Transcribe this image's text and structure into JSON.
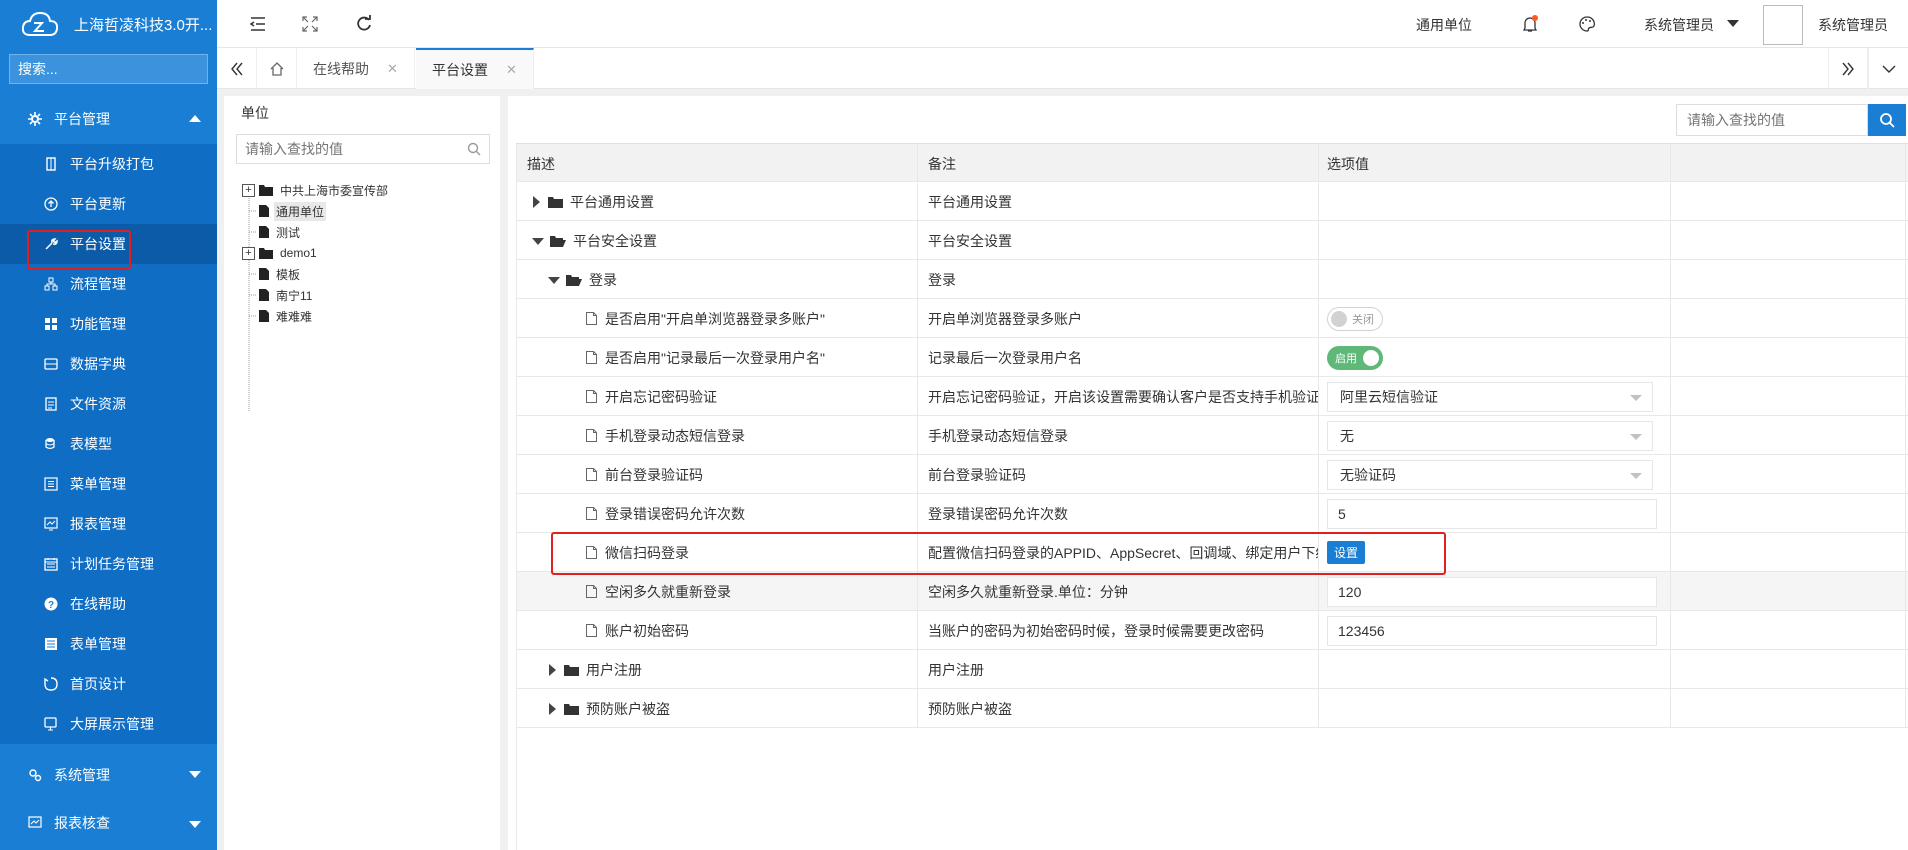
{
  "app": {
    "title": "上海哲凌科技3.0开..."
  },
  "sidebar": {
    "search_placeholder": "搜索...",
    "group_platform": "平台管理",
    "items": [
      {
        "label": "平台升级打包",
        "icon": "package-icon"
      },
      {
        "label": "平台更新",
        "icon": "upload-icon"
      },
      {
        "label": "平台设置",
        "icon": "wrench-icon"
      },
      {
        "label": "流程管理",
        "icon": "flow-icon"
      },
      {
        "label": "功能管理",
        "icon": "grid-icon"
      },
      {
        "label": "数据字典",
        "icon": "dictionary-icon"
      },
      {
        "label": "文件资源",
        "icon": "file-icon"
      },
      {
        "label": "表模型",
        "icon": "database-icon"
      },
      {
        "label": "菜单管理",
        "icon": "menu-icon"
      },
      {
        "label": "报表管理",
        "icon": "chart-icon"
      },
      {
        "label": "计划任务管理",
        "icon": "calendar-icon"
      },
      {
        "label": "在线帮助",
        "icon": "help-icon"
      },
      {
        "label": "表单管理",
        "icon": "form-icon"
      },
      {
        "label": "首页设计",
        "icon": "home-design-icon"
      },
      {
        "label": "大屏展示管理",
        "icon": "screen-icon"
      }
    ],
    "group_system": "系统管理",
    "group_report": "报表核查"
  },
  "header": {
    "unit": "通用单位",
    "user1": "系统管理员",
    "user2": "系统管理员"
  },
  "tabs": [
    {
      "label": "在线帮助"
    },
    {
      "label": "平台设置"
    }
  ],
  "tree": {
    "title": "单位",
    "search_placeholder": "请输入查找的值",
    "nodes": [
      "中共上海市委宣传部",
      "通用单位",
      "测试",
      "demo1",
      "模板",
      "南宁11",
      "难难难"
    ]
  },
  "grid": {
    "search_placeholder": "请输入查找的值",
    "headers": {
      "desc": "描述",
      "note": "备注",
      "value": "选项值"
    },
    "rows": [
      {
        "desc": "平台通用设置",
        "note": "平台通用设置"
      },
      {
        "desc": "平台安全设置",
        "note": "平台安全设置"
      },
      {
        "desc": "登录",
        "note": "登录"
      },
      {
        "desc": "是否启用\"开启单浏览器登录多账户\"",
        "note": "开启单浏览器登录多账户",
        "value": "关闭"
      },
      {
        "desc": "是否启用\"记录最后一次登录用户名\"",
        "note": "记录最后一次登录用户名",
        "value": "启用"
      },
      {
        "desc": "开启忘记密码验证",
        "note": "开启忘记密码验证，开启该设置需要确认客户是否支持手机验证",
        "value": "阿里云短信验证"
      },
      {
        "desc": "手机登录动态短信登录",
        "note": "手机登录动态短信登录",
        "value": "无"
      },
      {
        "desc": "前台登录验证码",
        "note": "前台登录验证码",
        "value": "无验证码"
      },
      {
        "desc": "登录错误密码允许次数",
        "note": "登录错误密码允许次数",
        "value": "5"
      },
      {
        "desc": "微信扫码登录",
        "note": "配置微信扫码登录的APPID、AppSecret、回调域、绑定用户下级",
        "value": "设置"
      },
      {
        "desc": "空闲多久就重新登录",
        "note": "空闲多久就重新登录.单位：分钟",
        "value": "120"
      },
      {
        "desc": "账户初始密码",
        "note": "当账户的密码为初始密码时候，登录时候需要更改密码",
        "value": "123456"
      },
      {
        "desc": "用户注册",
        "note": "用户注册"
      },
      {
        "desc": "预防账户被盗",
        "note": "预防账户被盗"
      }
    ]
  },
  "colors": {
    "primary": "#1a7fd4",
    "switch_on": "#5fb878",
    "highlight": "#e02020"
  }
}
